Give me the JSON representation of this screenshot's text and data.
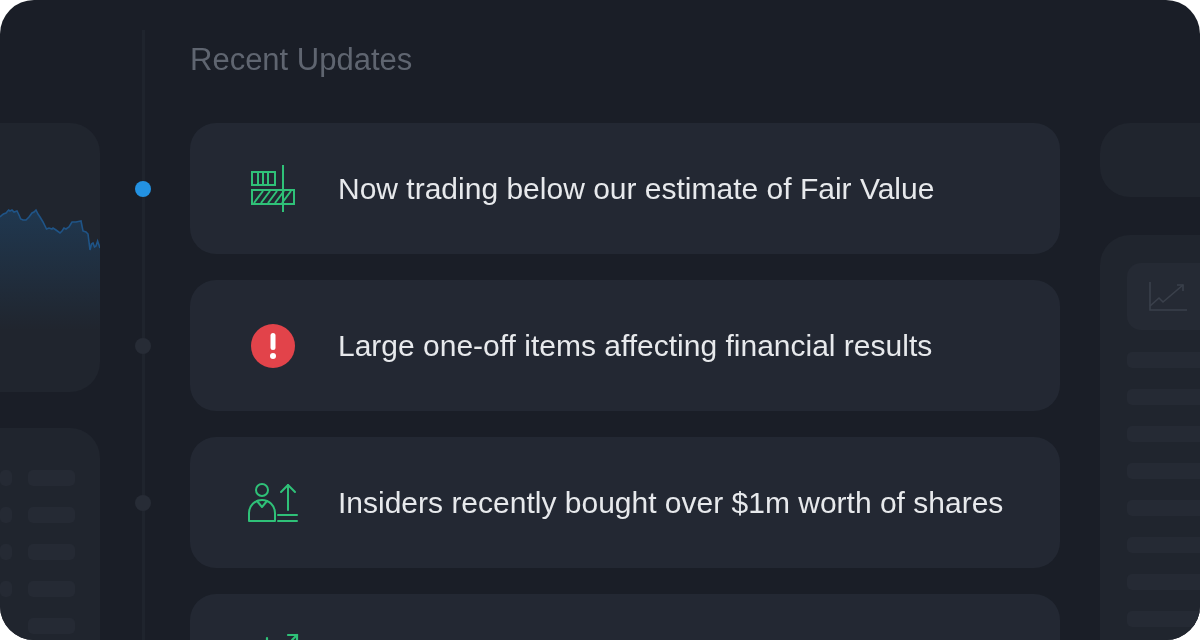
{
  "title": "Recent Updates",
  "updates": [
    {
      "kind": "valuation",
      "text": "Now trading below our estimate of Fair Value",
      "selected": true
    },
    {
      "kind": "risk",
      "text": "Large one-off items affecting financial results",
      "selected": false
    },
    {
      "kind": "insider",
      "text": "Insiders recently bought over $1m worth of shares",
      "selected": false
    },
    {
      "kind": "growth"
    }
  ]
}
